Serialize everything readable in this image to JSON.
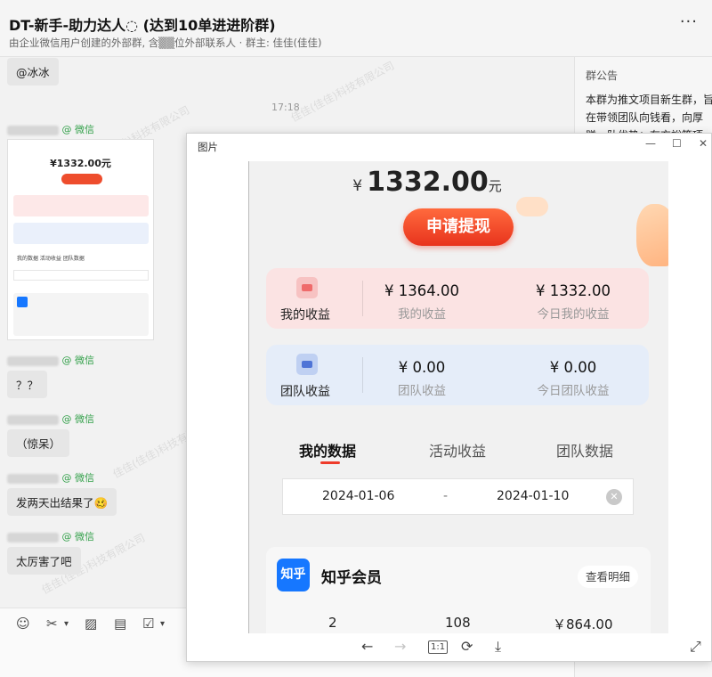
{
  "chat": {
    "title": "DT-新手-助力达人◌ (达到10单进进阶群)",
    "subtitle": "由企业微信用户创建的外部群, 含▒▒位外部联系人 · 群主: 佳佳(佳佳)",
    "more_label": "···",
    "timestamp": "17:18",
    "wechat_tag": "@ 微信",
    "messages": [
      {
        "text": "@冰冰"
      },
      {
        "text": "？？"
      },
      {
        "text": "（惊呆）"
      },
      {
        "text": "发两天出结果了🥴"
      },
      {
        "text": "太厉害了吧"
      }
    ],
    "watermark": "佳佳(佳佳)科技有限公司"
  },
  "thumbnail": {
    "amount": "¥1332.00元",
    "tabs": "我的数据   活动收益   团队数据"
  },
  "toolbar": {
    "emoji": "☺",
    "scissors": "✂",
    "image": "▨",
    "file": "▤",
    "check": "☑",
    "more": "▾"
  },
  "announcement": {
    "title": "群公告",
    "body": "本群为推文项目新生群，旨在带领团队向钱看，向厚赚。队优势：有充裕等项目，上"
  },
  "viewer": {
    "title": "图片",
    "minimize": "—",
    "maximize": "☐",
    "close": "✕",
    "amount": {
      "yen": "¥",
      "value": "1332.00",
      "unit": "元"
    },
    "withdraw_label": "申请提现",
    "my_card": {
      "label": "我的收益",
      "v1": "¥ 1364.00",
      "s1": "我的收益",
      "v2": "¥ 1332.00",
      "s2": "今日我的收益"
    },
    "team_card": {
      "label": "团队收益",
      "v1": "¥ 0.00",
      "s1": "团队收益",
      "v2": "¥ 0.00",
      "s2": "今日团队收益"
    },
    "tabs": [
      "我的数据",
      "活动收益",
      "团队数据"
    ],
    "date_start": "2024-01-06",
    "date_dash": "-",
    "date_end": "2024-01-10",
    "date_clear": "✕",
    "zhihu": {
      "logo": "知乎",
      "name": "知乎会员",
      "detail": "查看明细",
      "n1": "2",
      "n2": "108",
      "n3": "￥864.00"
    },
    "bottom_tools": {
      "prev": "←",
      "next": "→",
      "one_to_one": "1:1",
      "rotate": "⟳",
      "download": "⤓",
      "fullscreen": "⤢"
    }
  }
}
